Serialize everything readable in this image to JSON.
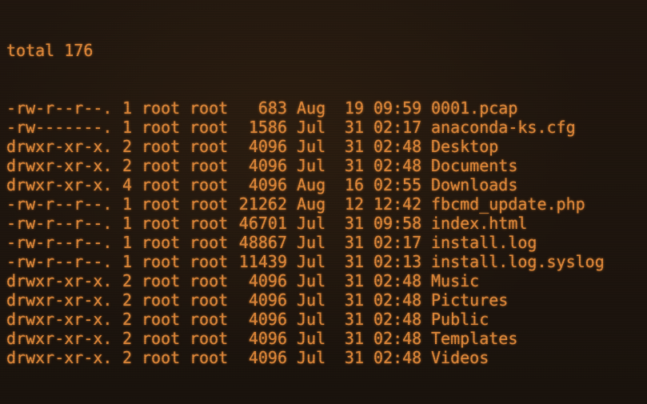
{
  "terminal": {
    "total_line": "total 176",
    "entries": [
      {
        "perms": "-rw-r--r--.",
        "links": "1",
        "owner": "root",
        "group": "root",
        "size": "683",
        "month": "Aug",
        "day": "19",
        "time": "09:59",
        "name": "0001.pcap"
      },
      {
        "perms": "-rw-------.",
        "links": "1",
        "owner": "root",
        "group": "root",
        "size": "1586",
        "month": "Jul",
        "day": "31",
        "time": "02:17",
        "name": "anaconda-ks.cfg"
      },
      {
        "perms": "drwxr-xr-x.",
        "links": "2",
        "owner": "root",
        "group": "root",
        "size": "4096",
        "month": "Jul",
        "day": "31",
        "time": "02:48",
        "name": "Desktop"
      },
      {
        "perms": "drwxr-xr-x.",
        "links": "2",
        "owner": "root",
        "group": "root",
        "size": "4096",
        "month": "Jul",
        "day": "31",
        "time": "02:48",
        "name": "Documents"
      },
      {
        "perms": "drwxr-xr-x.",
        "links": "4",
        "owner": "root",
        "group": "root",
        "size": "4096",
        "month": "Aug",
        "day": "16",
        "time": "02:55",
        "name": "Downloads"
      },
      {
        "perms": "-rw-r--r--.",
        "links": "1",
        "owner": "root",
        "group": "root",
        "size": "21262",
        "month": "Aug",
        "day": "12",
        "time": "12:42",
        "name": "fbcmd_update.php"
      },
      {
        "perms": "-rw-r--r--.",
        "links": "1",
        "owner": "root",
        "group": "root",
        "size": "46701",
        "month": "Jul",
        "day": "31",
        "time": "09:58",
        "name": "index.html"
      },
      {
        "perms": "-rw-r--r--.",
        "links": "1",
        "owner": "root",
        "group": "root",
        "size": "48867",
        "month": "Jul",
        "day": "31",
        "time": "02:17",
        "name": "install.log"
      },
      {
        "perms": "-rw-r--r--.",
        "links": "1",
        "owner": "root",
        "group": "root",
        "size": "11439",
        "month": "Jul",
        "day": "31",
        "time": "02:13",
        "name": "install.log.syslog"
      },
      {
        "perms": "drwxr-xr-x.",
        "links": "2",
        "owner": "root",
        "group": "root",
        "size": "4096",
        "month": "Jul",
        "day": "31",
        "time": "02:48",
        "name": "Music"
      },
      {
        "perms": "drwxr-xr-x.",
        "links": "2",
        "owner": "root",
        "group": "root",
        "size": "4096",
        "month": "Jul",
        "day": "31",
        "time": "02:48",
        "name": "Pictures"
      },
      {
        "perms": "drwxr-xr-x.",
        "links": "2",
        "owner": "root",
        "group": "root",
        "size": "4096",
        "month": "Jul",
        "day": "31",
        "time": "02:48",
        "name": "Public"
      },
      {
        "perms": "drwxr-xr-x.",
        "links": "2",
        "owner": "root",
        "group": "root",
        "size": "4096",
        "month": "Jul",
        "day": "31",
        "time": "02:48",
        "name": "Templates"
      },
      {
        "perms": "drwxr-xr-x.",
        "links": "2",
        "owner": "root",
        "group": "root",
        "size": "4096",
        "month": "Jul",
        "day": "31",
        "time": "02:48",
        "name": "Videos"
      }
    ]
  },
  "colors": {
    "background": "#1d150e",
    "text": "#e2893a"
  }
}
